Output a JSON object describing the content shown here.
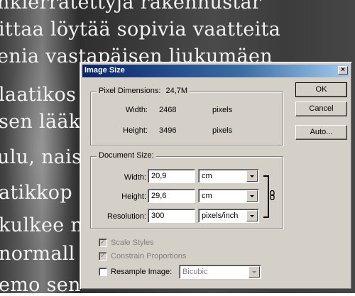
{
  "background_text": [
    "nkierratettyja rakennustar",
    "ittaa löytää sopivia vaatteita",
    "enia vastapäisen liukumäen",
    "laatikos",
    "sen lääk",
    "ulu, nais",
    "atikkop",
    "kulkee n",
    "normall",
    "emo sen"
  ],
  "dialog": {
    "title": "Image Size",
    "close_glyph": "×",
    "pixel_dimensions": {
      "legend": "Pixel Dimensions:",
      "size": "24,7M",
      "width_label": "Width:",
      "width_value": "2468",
      "width_unit": "pixels",
      "height_label": "Height:",
      "height_value": "3496",
      "height_unit": "pixels"
    },
    "document_size": {
      "legend": "Document Size:",
      "width_label": "Width:",
      "width_value": "20,9",
      "width_unit": "cm",
      "height_label": "Height:",
      "height_value": "29,6",
      "height_unit": "cm",
      "resolution_label": "Resolution:",
      "resolution_value": "300",
      "resolution_unit": "pixels/inch"
    },
    "options": {
      "scale_styles": "Scale Styles",
      "scale_styles_checked": true,
      "constrain_proportions": "Constrain Proportions",
      "constrain_checked": true,
      "resample_image": "Resample Image:",
      "resample_checked": false,
      "resample_method": "Bicubic"
    },
    "buttons": {
      "ok": "OK",
      "cancel": "Cancel",
      "auto": "Auto..."
    },
    "link_icon": "chain-link-icon"
  }
}
